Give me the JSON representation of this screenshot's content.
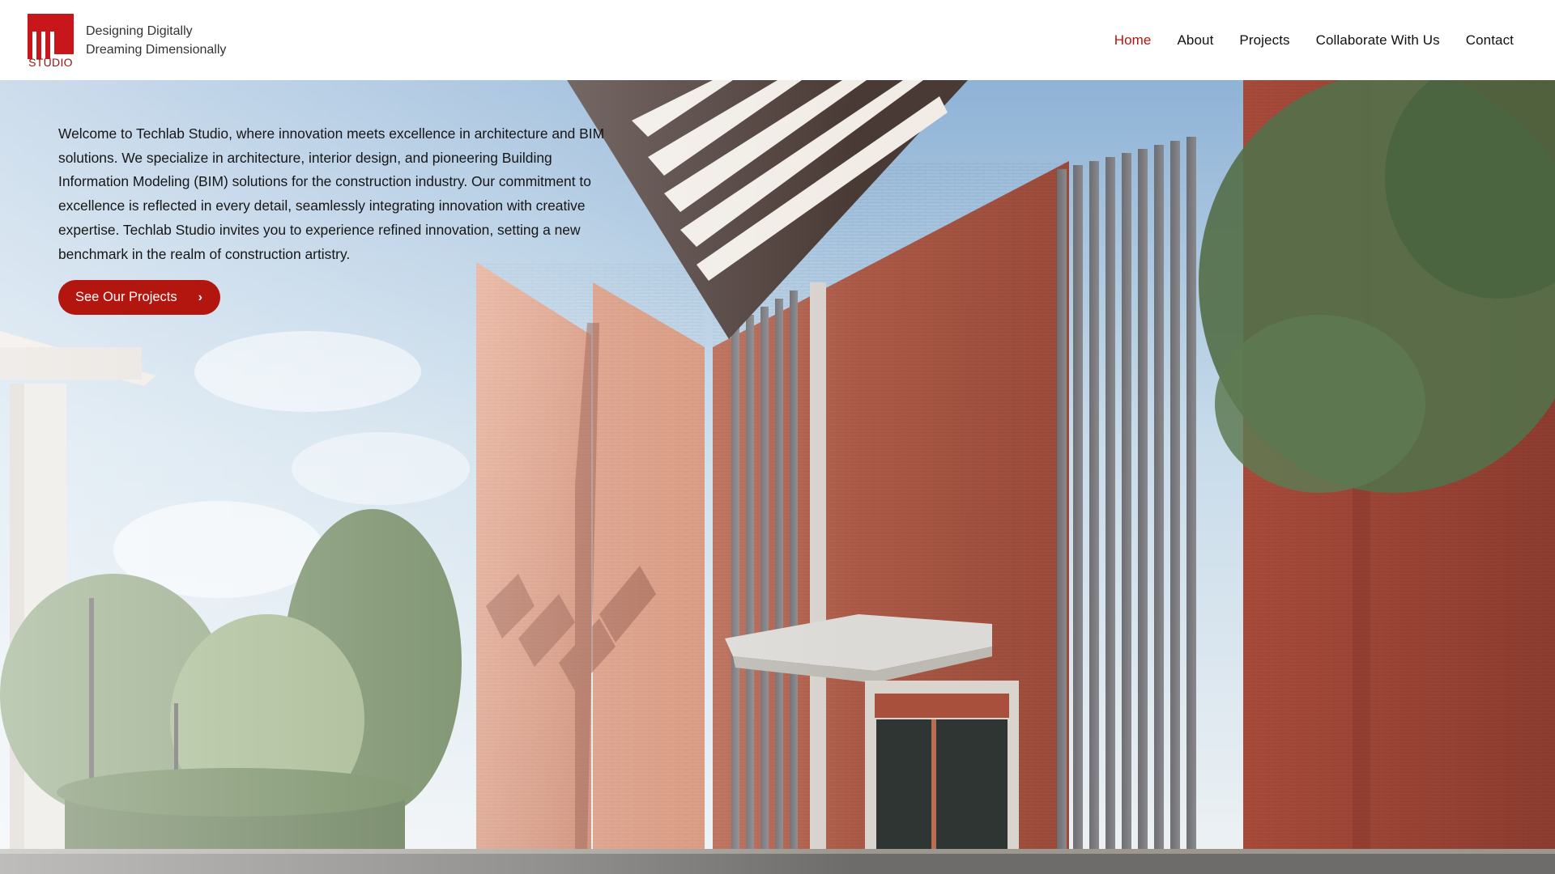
{
  "brand": {
    "logo_text": "STUDIO",
    "tagline_line1": "Designing Digitally",
    "tagline_line2": "Dreaming Dimensionally",
    "logo_color": "#c8171a"
  },
  "nav": {
    "items": [
      {
        "label": "Home",
        "active": true
      },
      {
        "label": "About",
        "active": false
      },
      {
        "label": "Projects",
        "active": false
      },
      {
        "label": "Collaborate With Us",
        "active": false
      },
      {
        "label": "Contact",
        "active": false
      }
    ],
    "active_color": "#b3160f"
  },
  "hero": {
    "text": "Welcome to Techlab Studio, where innovation meets excellence in architecture and BIM solutions. We specialize in architecture, interior design, and pioneering Building Information Modeling (BIM) solutions for the construction industry. Our commitment to excellence is reflected in every detail, seamlessly integrating innovation with creative expertise. Techlab Studio invites you to experience refined innovation, setting a new benchmark in the realm of construction artistry.",
    "cta_label": "See Our Projects",
    "cta_icon": "chevron-right-icon",
    "cta_color": "#b3160f"
  }
}
